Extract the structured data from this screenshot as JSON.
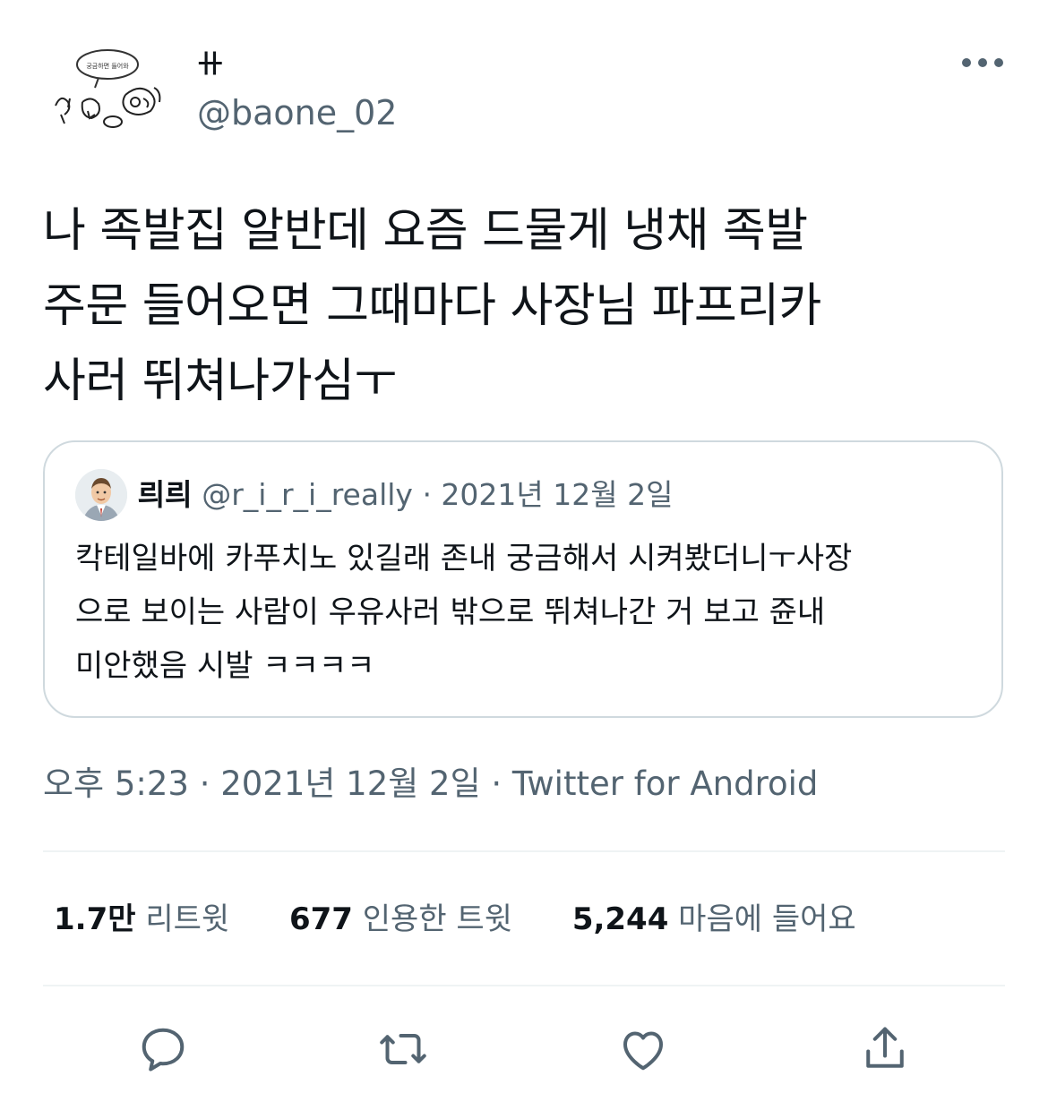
{
  "author": {
    "display_name": "ꔠ",
    "handle": "@baone_02",
    "avatar_speech_text": "궁금하면 들어와"
  },
  "more_icon": "more-horizontal-icon",
  "tweet_text": "나 족발집 알반데 요즘 드물게 냉채 족발\n주문 들어오면 그때마다 사장님 파프리카\n사러 뛰쳐나가심ㅜ",
  "quote": {
    "name": "릐릐",
    "handle": "@r_i_r_i_really",
    "date": "· 2021년 12월 2일",
    "text": "칵테일바에 카푸치노 있길래 존내 궁금해서 시켜봤더니ㅜ사장\n으로 보이는 사람이 우유사러 밖으로 뛰쳐나간 거 보고 쥰내\n미안했음 시발 ㅋㅋㅋㅋ"
  },
  "meta": "오후 5:23 · 2021년 12월 2일 · Twitter for Android",
  "stats": [
    {
      "value": "1.7만",
      "label": "리트윗"
    },
    {
      "value": "677",
      "label": "인용한 트윗"
    },
    {
      "value": "5,244",
      "label": "마음에 들어요"
    }
  ],
  "actions": [
    "reply-icon",
    "retweet-icon",
    "like-icon",
    "share-icon"
  ],
  "colors": {
    "text": "#0f1419",
    "secondary": "#536471",
    "border": "#cfd9de",
    "divider": "#eff3f4"
  }
}
